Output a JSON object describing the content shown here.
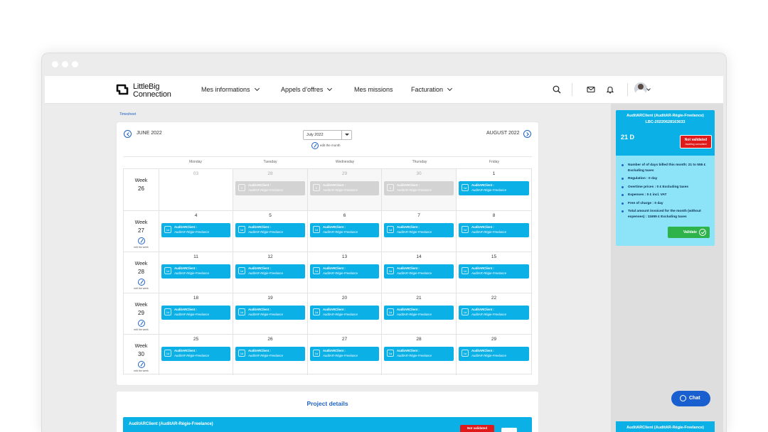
{
  "brand": {
    "line1": "LittleBig",
    "line2": "Connection"
  },
  "nav": {
    "menu": [
      "Mes informations",
      "Appels d’offres",
      "Mes missions",
      "Facturation"
    ],
    "icons": [
      "search-icon",
      "mail-icon",
      "bell-icon",
      "avatar"
    ]
  },
  "breadcrumb": "Timesheet",
  "calendar": {
    "prev_month": "JUNE 2022",
    "next_month": "AUGUST 2022",
    "selected_month": "July 2022",
    "edit_month_label": "edit the month",
    "edit_week_label": "edit the week",
    "week_label": "Week",
    "day_names": [
      "Monday",
      "Tuesday",
      "Wednesday",
      "Thursday",
      "Friday"
    ],
    "weeks": [
      {
        "number": "26",
        "days": [
          "03",
          "28",
          "29",
          "30",
          "1"
        ]
      },
      {
        "number": "27",
        "days": [
          "4",
          "5",
          "6",
          "7",
          "8"
        ]
      },
      {
        "number": "28",
        "days": [
          "11",
          "12",
          "13",
          "14",
          "15"
        ]
      },
      {
        "number": "29",
        "days": [
          "18",
          "19",
          "20",
          "21",
          "22"
        ]
      },
      {
        "number": "30",
        "days": [
          "25",
          "26",
          "27",
          "28",
          "29"
        ]
      }
    ],
    "event": {
      "badge": "1d",
      "past_badge": "0",
      "line1": "AuditARClient :",
      "line2": "AuditAR-Régie-Freelance"
    }
  },
  "project_details": {
    "title": "Project details",
    "bar_title": "AuditARClient (AuditAR-Régie-Freelance)",
    "status": "Not validated"
  },
  "summary": {
    "title": "AuditARClient (AuditAR-Régie-Freelance)",
    "ref": "LBC-20220628163633",
    "days": "21 D",
    "status": "Not validated",
    "status_sub": "Awaiting consultant",
    "items": [
      "Number of of days billed this month: 21 to 555 £ Excluding taxes",
      "Regulation : 0 day",
      "Overtime prices : 0 £ Excluding taxes",
      "Expenses : 0 £ incl. VAT",
      "Free of charge : 0 day",
      "Total amount invoiced for the month (without expenses) : 11655 £ Excluding taxes"
    ],
    "validate_label": "Validate"
  },
  "summary2_title": "AuditARClient (AuditAR-Régie-Freelance)",
  "chat_label": "Chat",
  "colors": {
    "accent": "#0bb1e6",
    "primary": "#1e63c4",
    "danger": "#e01a1a",
    "success": "#2eb34a"
  }
}
